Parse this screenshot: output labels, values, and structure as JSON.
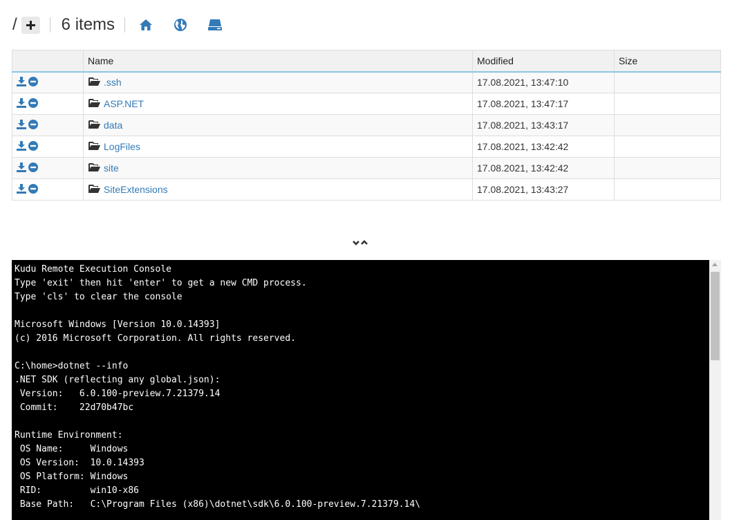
{
  "header": {
    "path": "/",
    "add_label": "+",
    "items_count": "6 items"
  },
  "table": {
    "columns": [
      "",
      "Name",
      "Modified",
      "Size"
    ],
    "rows": [
      {
        "name": ".ssh",
        "modified": "17.08.2021, 13:47:10",
        "size": ""
      },
      {
        "name": "ASP.NET",
        "modified": "17.08.2021, 13:47:17",
        "size": ""
      },
      {
        "name": "data",
        "modified": "17.08.2021, 13:43:17",
        "size": ""
      },
      {
        "name": "LogFiles",
        "modified": "17.08.2021, 13:42:42",
        "size": ""
      },
      {
        "name": "site",
        "modified": "17.08.2021, 13:42:42",
        "size": ""
      },
      {
        "name": "SiteExtensions",
        "modified": "17.08.2021, 13:43:27",
        "size": ""
      }
    ]
  },
  "console": {
    "lines": [
      "Kudu Remote Execution Console",
      "Type 'exit' then hit 'enter' to get a new CMD process.",
      "Type 'cls' to clear the console",
      "",
      "Microsoft Windows [Version 10.0.14393]",
      "(c) 2016 Microsoft Corporation. All rights reserved.",
      "",
      "C:\\home>dotnet --info",
      ".NET SDK (reflecting any global.json):",
      " Version:   6.0.100-preview.7.21379.14",
      " Commit:    22d70b47bc",
      "",
      "Runtime Environment:",
      " OS Name:     Windows",
      " OS Version:  10.0.14393",
      " OS Platform: Windows",
      " RID:         win10-x86",
      " Base Path:   C:\\Program Files (x86)\\dotnet\\sdk\\6.0.100-preview.7.21379.14\\"
    ]
  },
  "icons": {
    "home": "home-icon",
    "globe": "globe-icon",
    "drive": "drive-icon",
    "download": "download-icon",
    "delete": "minus-circle-icon",
    "folder": "folder-open-icon"
  },
  "colors": {
    "accent": "#337ab7",
    "header_border": "#8cc4e8",
    "console_bg": "#000000",
    "console_fg": "#ffffff"
  }
}
